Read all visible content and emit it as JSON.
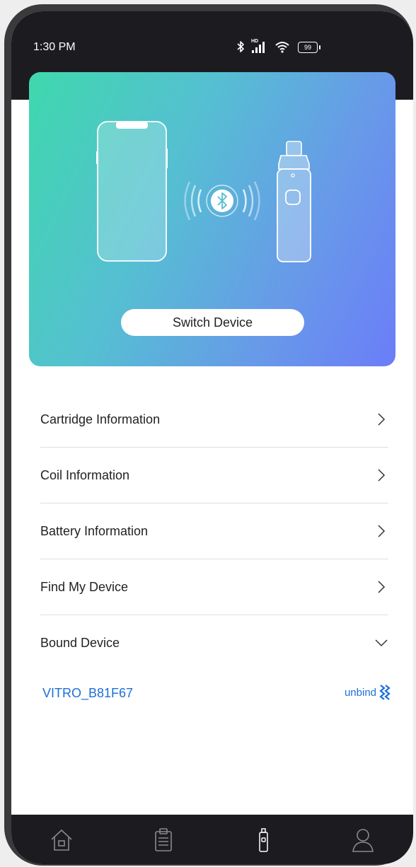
{
  "status_bar": {
    "time": "1:30 PM",
    "network_label": "HD",
    "battery_level": "99"
  },
  "hero": {
    "switch_label": "Switch Device",
    "icons": [
      "phone-illustration",
      "bluetooth-signal-icon",
      "vape-device-illustration"
    ],
    "gradient_colors": [
      "#3fd8ad",
      "#6b7df8"
    ]
  },
  "menu": {
    "items": [
      {
        "label": "Cartridge Information",
        "icon": "chevron-right-icon"
      },
      {
        "label": "Coil Information",
        "icon": "chevron-right-icon"
      },
      {
        "label": "Battery Information",
        "icon": "chevron-right-icon"
      },
      {
        "label": "Find My Device",
        "icon": "chevron-right-icon"
      },
      {
        "label": "Bound Device",
        "icon": "chevron-down-icon"
      }
    ]
  },
  "bound_device": {
    "name": "VITRO_B81F67",
    "unbind_label": "unbind",
    "accent": "#1c6fd9"
  },
  "tab_bar": {
    "tabs": [
      "home-icon",
      "clipboard-icon",
      "device-icon",
      "profile-icon"
    ]
  }
}
